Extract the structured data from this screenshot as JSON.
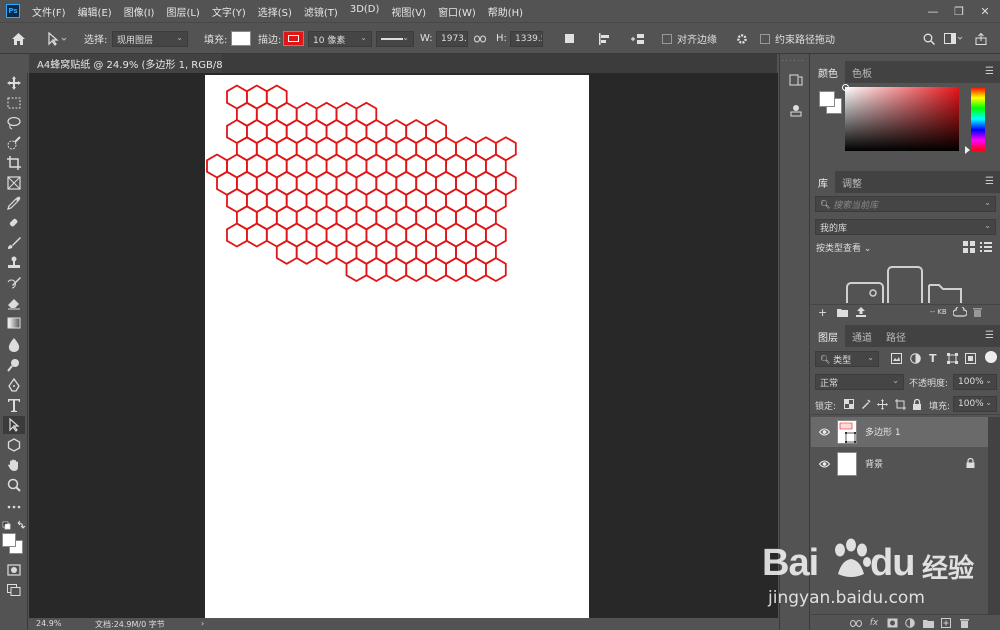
{
  "app": {
    "logo_text": "Ps"
  },
  "menu": [
    "文件(F)",
    "编辑(E)",
    "图像(I)",
    "图层(L)",
    "文字(Y)",
    "选择(S)",
    "滤镜(T)",
    "3D(D)",
    "视图(V)",
    "窗口(W)",
    "帮助(H)"
  ],
  "window": {
    "minimize": "—",
    "restore": "❐",
    "close": "✕"
  },
  "options": {
    "select_label": "选择:",
    "select_value": "现用图层",
    "fill_label": "填充:",
    "stroke_label": "描边:",
    "stroke_width": "10 像素",
    "w_label": "W:",
    "w_value": "1973.13",
    "h_label": "H:",
    "h_value": "1339.53",
    "align_edges": "对齐边缘",
    "constrain_path": "约束路径拖动",
    "stroke_color": "#e01616"
  },
  "document": {
    "tab_title": "A4蜂窝贴纸 @ 24.9% (多边形 1, RGB/8) *",
    "zoom": "24.9%",
    "doc_info": "文档:24.9M/0 字节",
    "status_arrow": "›"
  },
  "honeycomb": {
    "color": "#e01616",
    "rows": 13,
    "cols": 15
  },
  "color_panel": {
    "tabs": [
      "颜色",
      "色板"
    ]
  },
  "library_panel": {
    "tabs": [
      "库",
      "调整"
    ],
    "search_placeholder": "搜索当前库",
    "library_name": "我的库",
    "view_by": "按类型查看",
    "size": "-- KB"
  },
  "layers_panel": {
    "tabs": [
      "图层",
      "通道",
      "路径"
    ],
    "filter_type": "类型",
    "blend_mode": "正常",
    "opacity_label": "不透明度:",
    "opacity_value": "100%",
    "lock_label": "锁定:",
    "fill_label": "填充:",
    "fill_value": "100%",
    "layers": [
      {
        "name": "多边形 1"
      },
      {
        "name": "背景"
      }
    ]
  },
  "watermark": {
    "brand_left": "Bai",
    "brand_right": "du",
    "brand_cn": "经验",
    "url": "jingyan.baidu.com"
  }
}
